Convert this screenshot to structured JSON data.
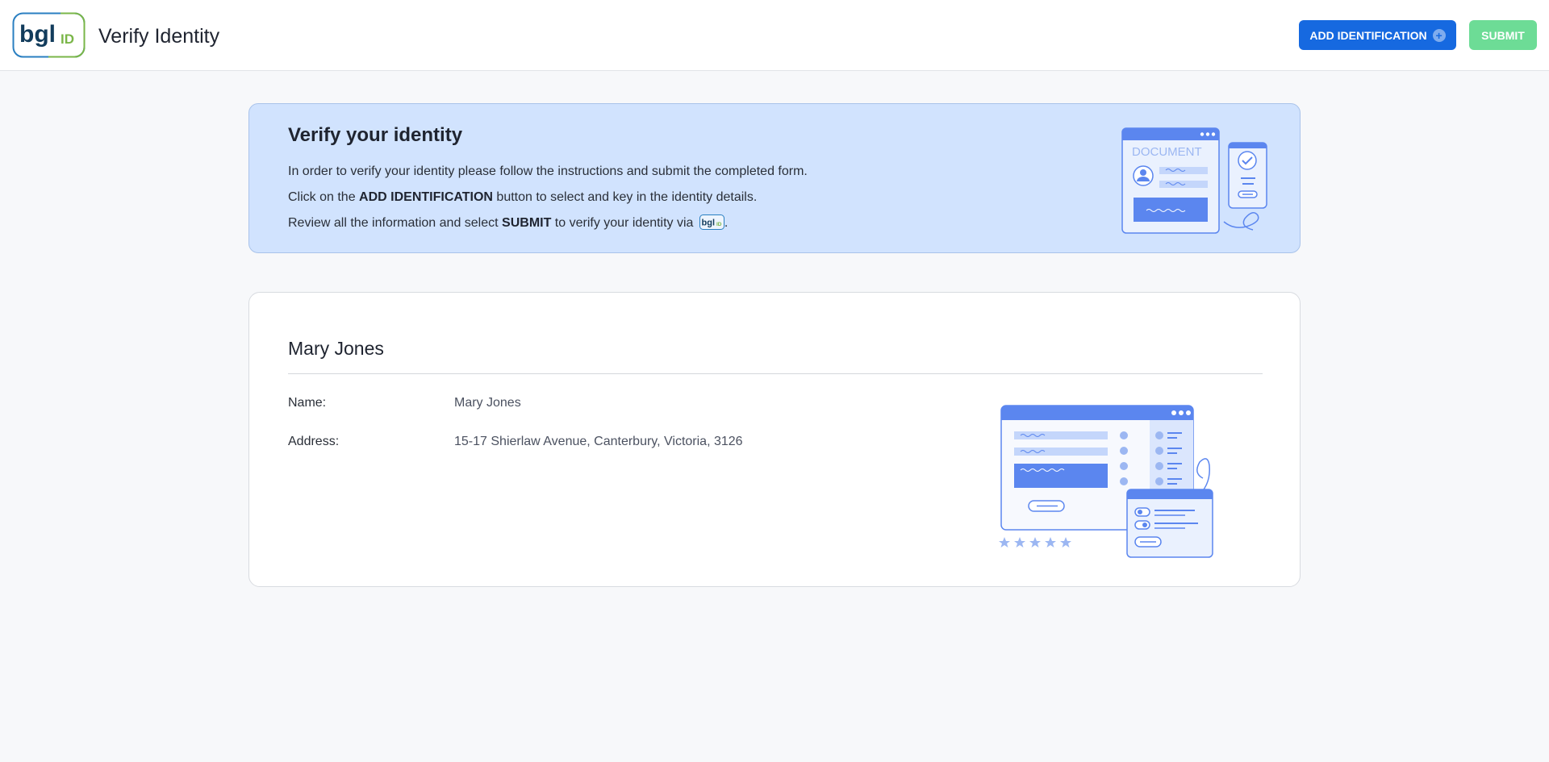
{
  "header": {
    "logo_text": "bglID",
    "title": "Verify Identity",
    "add_button_label": "ADD IDENTIFICATION",
    "add_button_icon": "plus-circle-icon",
    "submit_button_label": "SUBMIT"
  },
  "banner": {
    "title": "Verify your identity",
    "line1": "In order to verify your identity please follow the instructions and submit the completed form.",
    "line2_prefix": "Click on the ",
    "line2_bold": "ADD IDENTIFICATION",
    "line2_suffix": " button to select and key in the identity details.",
    "line3_prefix": "Review all the information and select ",
    "line3_bold": "SUBMIT",
    "line3_suffix": " to verify your identity via ",
    "line3_end": ".",
    "illustration_label": "DOCUMENT"
  },
  "person": {
    "name_heading": "Mary Jones",
    "fields": [
      {
        "label": "Name:",
        "value": "Mary Jones"
      },
      {
        "label": "Address:",
        "value": "15-17 Shierlaw Avenue, Canterbury, Victoria, 3126"
      }
    ]
  },
  "colors": {
    "primary": "#1669e0",
    "submit_disabled": "#6ddc96",
    "banner_bg": "#d1e3fe",
    "logo_navy": "#123c5c",
    "logo_green": "#7ab648",
    "illustration_blue": "#5b86ef"
  }
}
